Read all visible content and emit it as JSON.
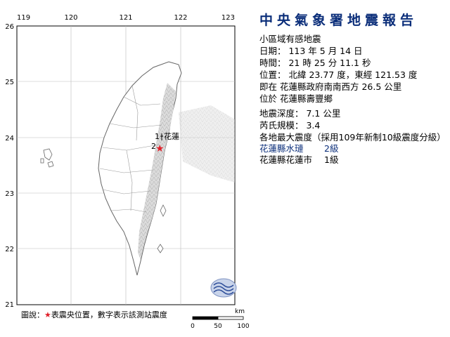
{
  "map": {
    "lon_ticks": [
      "119",
      "120",
      "121",
      "122",
      "123"
    ],
    "lat_ticks": [
      "26",
      "25",
      "24",
      "23",
      "22",
      "21"
    ],
    "station_labels": [
      {
        "text": "1",
        "name": "花蓮"
      },
      {
        "text": "2",
        "name": ""
      }
    ],
    "epicenter_icon": "red-star",
    "scale": {
      "unit": "km",
      "ticks": [
        "0",
        "50",
        "100"
      ]
    },
    "agency_logo": "cwa-logo",
    "colors": {
      "epicenter": "#e0202a",
      "station_text": "#0b2e7a",
      "title": "#0b2e7a"
    }
  },
  "legend": {
    "prefix": "圖說：",
    "star": "★",
    "text": "表震央位置，數字表示該測站震度"
  },
  "report": {
    "title": "中央氣象署地震報告",
    "subtitle": "小區域有感地震",
    "date": "日期： 113 年 5 月 14 日",
    "time": "時間： 21 時 25 分 11.1 秒",
    "position_line1": "位置： 北緯 23.77 度，東經 121.53 度",
    "position_line2": "即在 花蓮縣政府南南西方 26.5 公里",
    "position_line3": "位於 花蓮縣壽豐鄉",
    "depth": "地震深度： 7.1 公里",
    "magnitude": "芮氏規模： 3.4",
    "intensity_header": "各地最大震度（採用109年新制10級震度分級）",
    "intensities": [
      {
        "name": "花蓮縣水璉",
        "level": "2級"
      },
      {
        "name": "花蓮縣花蓮市",
        "level": "1級"
      }
    ]
  }
}
